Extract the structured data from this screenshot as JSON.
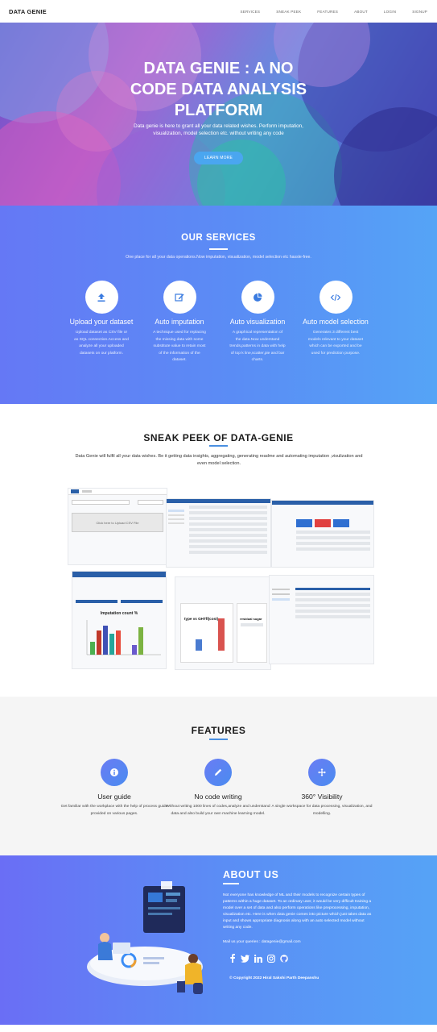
{
  "nav": {
    "brand": "DATA GENIE",
    "links": [
      "SERVICES",
      "SNEAK PEEK",
      "FEATURES",
      "ABOUT",
      "LOGIN",
      "SIGNUP"
    ]
  },
  "hero": {
    "title_line1": "DATA GENIE : A NO",
    "title_line2": "CODE DATA ANALYSIS",
    "title_line3": "PLATFORM",
    "subtitle": "Data genie is here to grant all your data related wishes. Perform imputation, visualization, model selection etc. without writing any code",
    "button": "LEARN MORE"
  },
  "services": {
    "title": "OUR SERVICES",
    "subtitle": "One place for all your data operations.Now imputation, visualization, model selection etc hassle-free.",
    "items": [
      {
        "title": "Upload your dataset",
        "icon": "upload-icon",
        "desc": "Upload dataset as CSV file or as SQL connection.Access and analyze all your uploaded datasets on our platform."
      },
      {
        "title": "Auto imputation",
        "icon": "edit-icon",
        "desc": "A technique used for replacing the missing data with some substitute value to retain most of the information of the dataset."
      },
      {
        "title": "Auto visualization",
        "icon": "pie-chart-icon",
        "desc": "A graphical representation of the data.Now understand trends,patterns in data with help of top k line,scatter,pie and bar charts."
      },
      {
        "title": "Auto model selection",
        "icon": "code-icon",
        "desc": "Generates 3 different best models relevant to your dataset which can be exported and be used for prediction purpose."
      }
    ]
  },
  "sneak": {
    "title": "SNEAK PEEK OF DATA-GENIE",
    "subtitle": "Data Genie will fulfil all your data wishes. Be it getting data insights, aggregating, generating readme and automating imputation ,visulization and even model selection.",
    "upload_hint": "Click here to Upload CSV File",
    "chart_label": "Imputation count %",
    "chart_label2": "type vs GHTfl(cost)",
    "chart_label3": "residual sugar"
  },
  "features": {
    "title": "FEATURES",
    "items": [
      {
        "title": "User guide",
        "icon": "info-icon",
        "desc": "Get familiar with the workplace with the help of process guide provided on various pages."
      },
      {
        "title": "No code writing",
        "icon": "pencil-icon",
        "desc": "Without writing 1000 lines of codes,analyze and understand data and also build your own machine learning model."
      },
      {
        "title": "360° Visibility",
        "icon": "arrows-icon",
        "desc": "A single workspace for data processing, visualization, and modelling."
      }
    ]
  },
  "about": {
    "title": "ABOUT US",
    "text": "Not everyone has knowledge of ML and their models to recognize certain types of patterns within a huge dataset. To an ordinary user, it would be very difficult training a model over a set of data and also perform operations like preprocessing, imputation, visualization etc. Here is when data genie comes into picture which just takes data as input and shows appropriate diagnosis along with an auto selected model without writing any code.",
    "mail": "Mail us your queries : datagenie@gmail.com",
    "copyright": "© Copyright 2022 Hiral Sakshi Parth Deepanshu",
    "socials": [
      "facebook-icon",
      "twitter-icon",
      "linkedin-icon",
      "instagram-icon",
      "github-icon"
    ]
  },
  "colors": {
    "services_bg": "#6578f5",
    "about_bg": "#5b8df5",
    "accent": "#4a90e2",
    "button": "#4aa6f0"
  }
}
